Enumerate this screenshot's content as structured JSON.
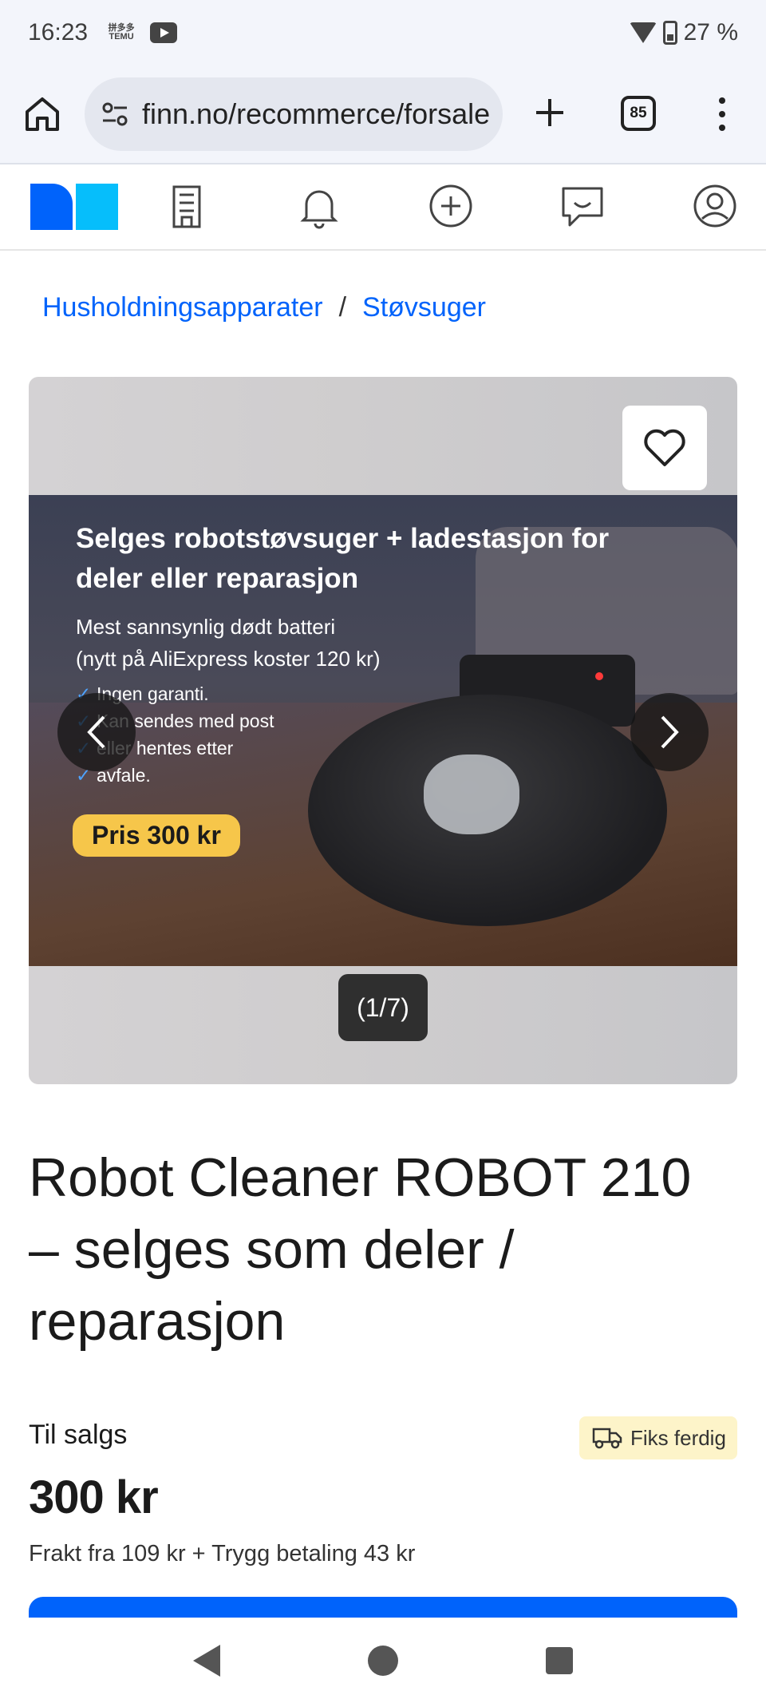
{
  "status": {
    "time": "16:23",
    "temu_label": "拼多多\nTEMU",
    "battery": "27 %"
  },
  "browser": {
    "url": "finn.no/recommerce/forsale",
    "tab_count": "85"
  },
  "breadcrumb": {
    "items": [
      "Husholdningsapparater",
      "Støvsuger"
    ],
    "separator": "/"
  },
  "gallery": {
    "image_headline": "Selges robotstøvsuger + ladestasjon for deler eller reparasjon",
    "image_sub1": "Mest sannsynlig dødt batteri",
    "image_sub2": "(nytt på AliExpress koster 120 kr)",
    "image_bullets": [
      "Ingen garanti.",
      "Kan sendes med post",
      "eller hentes etter",
      "avfale."
    ],
    "image_price": "Pris 300 kr",
    "counter": "(1/7)"
  },
  "listing": {
    "title": "Robot Cleaner ROBOT 210 – selges som deler / reparasjon",
    "status": "Til salgs",
    "badge": "Fiks ferdig",
    "price": "300 kr",
    "shipping": "Frakt fra 109 kr + Trygg betaling 43 kr"
  },
  "colors": {
    "brand_blue": "#0063fb",
    "brand_cyan": "#06befb",
    "badge_bg": "#fdf4c9",
    "price_pill": "#f6c64a"
  }
}
